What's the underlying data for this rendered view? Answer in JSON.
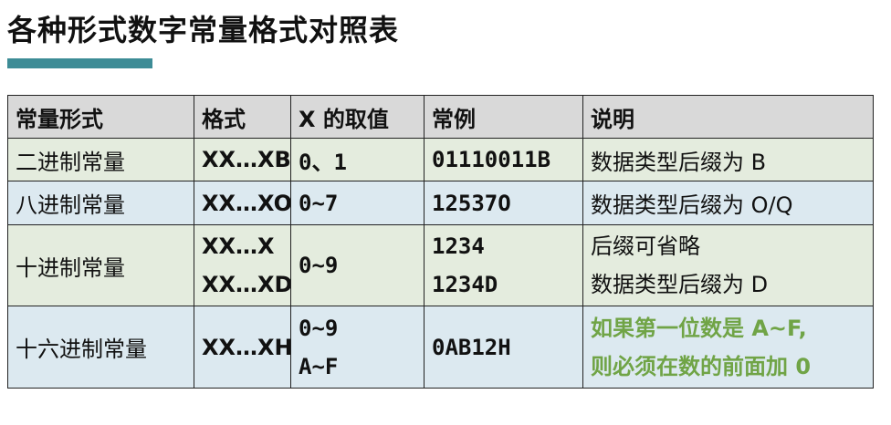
{
  "title": "各种形式数字常量格式对照表",
  "table": {
    "headers": [
      "常量形式",
      "格式",
      "X 的取值",
      "常例",
      "说明"
    ],
    "rows": [
      {
        "form": "二进制常量",
        "format": [
          "XX…XB"
        ],
        "values": [
          "0、1"
        ],
        "example": [
          "01110011B"
        ],
        "note": [
          "数据类型后缀为 B"
        ]
      },
      {
        "form": "八进制常量",
        "format": [
          "XX…XO"
        ],
        "values": [
          "0~7"
        ],
        "example": [
          "12537O"
        ],
        "note": [
          "数据类型后缀为 O/Q"
        ]
      },
      {
        "form": "十进制常量",
        "format": [
          "XX…X",
          "XX…XD"
        ],
        "values": [
          "0~9"
        ],
        "example": [
          "1234",
          "1234D"
        ],
        "note": [
          "后缀可省略",
          "数据类型后缀为 D"
        ]
      },
      {
        "form": "十六进制常量",
        "format": [
          "XX…XH"
        ],
        "values": [
          "0~9",
          "A~F"
        ],
        "example": [
          "0AB12H"
        ],
        "note": [
          "如果第一位数是 A~F,",
          "则必须在数的前面加 0"
        ]
      }
    ]
  },
  "colors": {
    "accent_bar": "#3d8c96",
    "header_bg": "#d9d9d9",
    "row_green": "#e4ecde",
    "row_blue": "#dce9f0",
    "note_green": "#70a446"
  }
}
